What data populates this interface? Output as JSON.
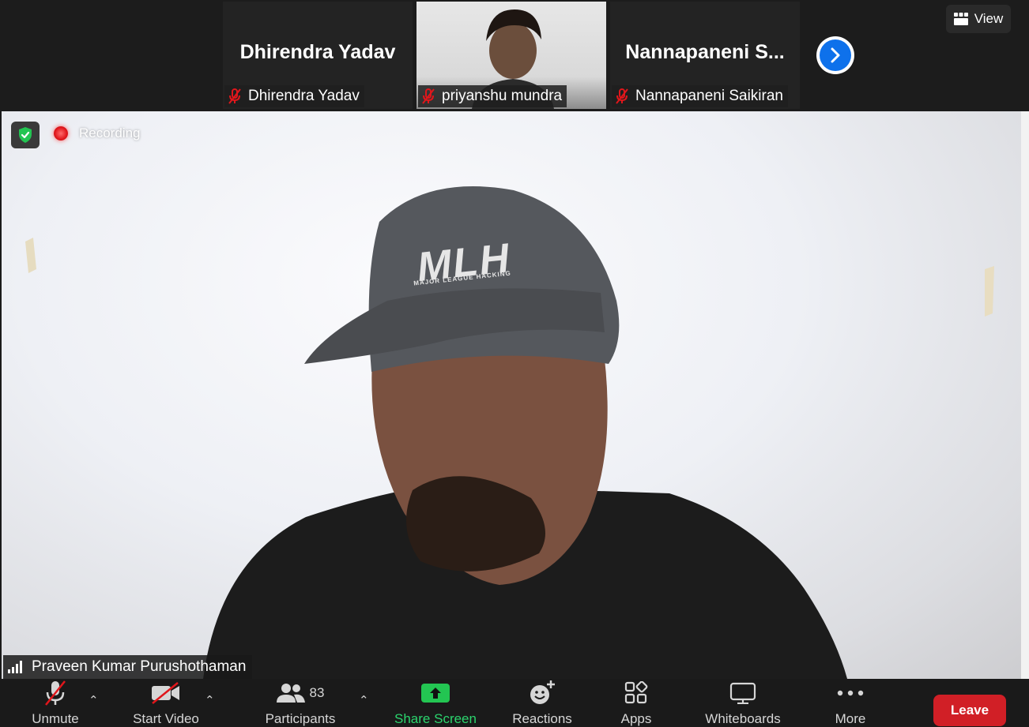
{
  "top_bar": {
    "tiles": [
      {
        "display_name": "Dhirendra Yadav",
        "label": "Dhirendra Yadav",
        "muted": true
      },
      {
        "display_name": "",
        "label": "priyanshu mundra",
        "muted": true
      },
      {
        "display_name": "Nannapaneni  S...",
        "label": "Nannapaneni Saikiran",
        "muted": true
      }
    ],
    "view_label": "View"
  },
  "main_video": {
    "recording_label": "Recording",
    "speaker_name": "Praveen Kumar Purushothaman",
    "cap_text": "MLH",
    "cap_subtext": "MAJOR LEAGUE HACKING"
  },
  "toolbar": {
    "unmute_label": "Unmute",
    "start_video_label": "Start Video",
    "participants_label": "Participants",
    "participants_count": "83",
    "share_screen_label": "Share Screen",
    "reactions_label": "Reactions",
    "apps_label": "Apps",
    "whiteboards_label": "Whiteboards",
    "more_label": "More",
    "leave_label": "Leave"
  },
  "colors": {
    "leave": "#d11f26",
    "share": "#2bd46d",
    "accent_blue": "#0e71eb",
    "mute_red": "#e0161b"
  }
}
